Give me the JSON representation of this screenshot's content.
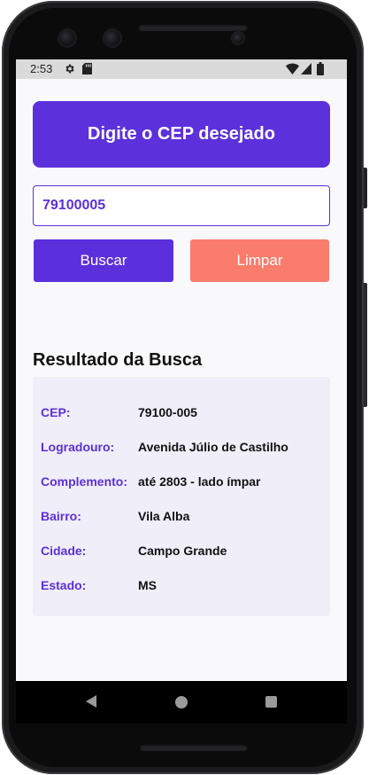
{
  "status_bar": {
    "time": "2:53",
    "icons": [
      "settings-icon",
      "sd-card-icon",
      "wifi-icon",
      "signal-icon",
      "battery-icon"
    ]
  },
  "header": {
    "title": "Digite o CEP desejado"
  },
  "search": {
    "cep_value": "79100005"
  },
  "buttons": {
    "search_label": "Buscar",
    "clear_label": "Limpar"
  },
  "result": {
    "title": "Resultado da Busca",
    "fields": [
      {
        "label": "CEP:",
        "value": "79100-005"
      },
      {
        "label": "Logradouro:",
        "value": "Avenida Júlio de Castilho"
      },
      {
        "label": "Complemento:",
        "value": "até 2803 - lado ímpar"
      },
      {
        "label": "Bairro:",
        "value": "Vila Alba"
      },
      {
        "label": "Cidade:",
        "value": "Campo Grande"
      },
      {
        "label": "Estado:",
        "value": "MS"
      }
    ]
  },
  "nav_bar": {
    "icons": [
      "back-icon",
      "home-icon",
      "recents-icon"
    ]
  },
  "colors": {
    "primary": "#5c30db",
    "secondary": "#fa7c6c",
    "result_background": "#f0eef9",
    "screen_background": "#f9f8fa"
  }
}
